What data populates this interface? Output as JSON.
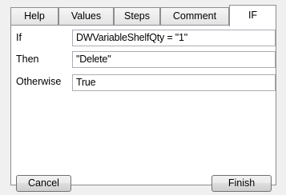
{
  "tabs": [
    {
      "label": "Help",
      "active": false
    },
    {
      "label": "Values",
      "active": false
    },
    {
      "label": "Steps",
      "active": false
    },
    {
      "label": "Comment",
      "active": false
    },
    {
      "label": "IF",
      "active": true
    }
  ],
  "form": {
    "if_label": "If",
    "if_value": "DWVariableShelfQty = \"1\"",
    "then_label": "Then",
    "then_value": "\"Delete\"",
    "otherwise_label": "Otherwise",
    "otherwise_value": "True"
  },
  "buttons": {
    "cancel": "Cancel",
    "finish": "Finish"
  }
}
